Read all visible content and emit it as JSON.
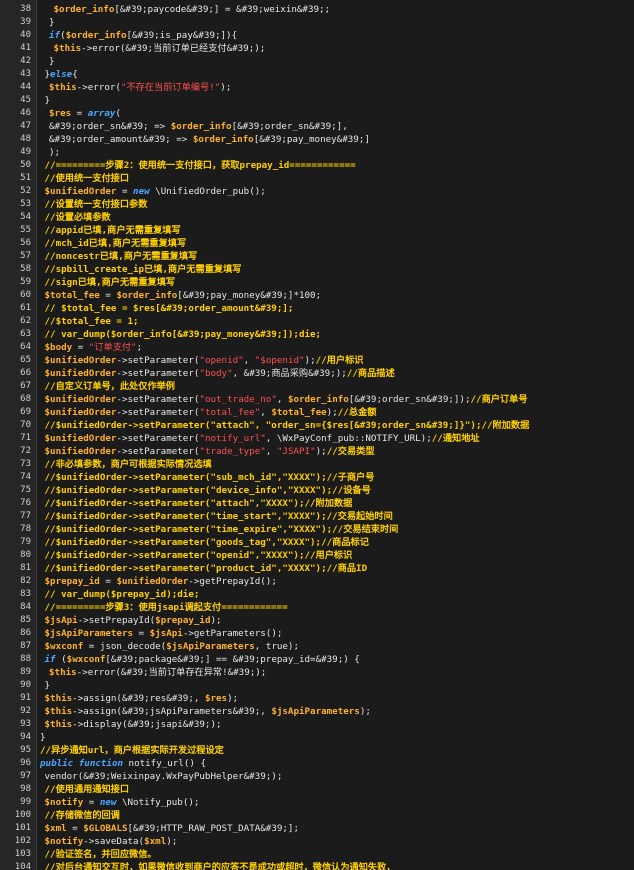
{
  "colors": {
    "background": "#1b1b1b",
    "gutter": "#262626",
    "line_number": "#cfcfcf",
    "plain": "#e6e6e6",
    "variable": "#ffb12b",
    "keyword": "#4aa8ff",
    "string": "#ff4f4f",
    "comment": "#ffd000"
  },
  "lines": [
    {
      "n": "38",
      "indent": 6,
      "tokens": [
        [
          "var",
          "$order_info"
        ],
        [
          "pl",
          "[&#39;paycode&#39;] = &#39;weixin&#39;;"
        ]
      ]
    },
    {
      "n": "39",
      "indent": 5,
      "tokens": [
        [
          "pl",
          "}"
        ]
      ]
    },
    {
      "n": "40",
      "indent": 5,
      "tokens": [
        [
          "kw",
          "if"
        ],
        [
          "pl",
          "("
        ],
        [
          "var",
          "$order_info"
        ],
        [
          "pl",
          "[&#39;is_pay&#39;]){"
        ]
      ]
    },
    {
      "n": "41",
      "indent": 6,
      "tokens": [
        [
          "var",
          "$this"
        ],
        [
          "pl",
          "->error(&#39;当前订单已经支付&#39;);"
        ]
      ]
    },
    {
      "n": "42",
      "indent": 5,
      "tokens": [
        [
          "pl",
          "}"
        ]
      ]
    },
    {
      "n": "43",
      "indent": 4,
      "tokens": [
        [
          "pl",
          "}"
        ],
        [
          "kw",
          "else"
        ],
        [
          "pl",
          "{"
        ]
      ]
    },
    {
      "n": "44",
      "indent": 5,
      "tokens": [
        [
          "var",
          "$this"
        ],
        [
          "pl",
          "->error("
        ],
        [
          "str",
          "\"不存在当前订单编号!\""
        ],
        [
          "pl",
          ");"
        ]
      ]
    },
    {
      "n": "45",
      "indent": 4,
      "tokens": [
        [
          "pl",
          "}"
        ]
      ]
    },
    {
      "n": "46",
      "indent": 5,
      "tokens": [
        [
          "var",
          "$res"
        ],
        [
          "pl",
          " = "
        ],
        [
          "kw",
          "array"
        ],
        [
          "pl",
          "("
        ]
      ]
    },
    {
      "n": "47",
      "indent": 5,
      "tokens": [
        [
          "pl",
          "&#39;order_sn&#39; => "
        ],
        [
          "var",
          "$order_info"
        ],
        [
          "pl",
          "[&#39;order_sn&#39;],"
        ]
      ]
    },
    {
      "n": "48",
      "indent": 5,
      "tokens": [
        [
          "pl",
          "&#39;order_amount&#39; => "
        ],
        [
          "var",
          "$order_info"
        ],
        [
          "pl",
          "[&#39;pay_money&#39;]"
        ]
      ]
    },
    {
      "n": "49",
      "indent": 5,
      "tokens": [
        [
          "pl",
          ");"
        ]
      ]
    },
    {
      "n": "50",
      "indent": 4,
      "tokens": [
        [
          "cm",
          "//=========步骤2：使用统一支付接口，获取prepay_id============"
        ]
      ]
    },
    {
      "n": "51",
      "indent": 4,
      "tokens": [
        [
          "cm",
          "//使用统一支付接口"
        ]
      ]
    },
    {
      "n": "52",
      "indent": 4,
      "tokens": [
        [
          "var",
          "$unifiedOrder"
        ],
        [
          "pl",
          " = "
        ],
        [
          "kw",
          "new"
        ],
        [
          "pl",
          " \\UnifiedOrder_pub();"
        ]
      ]
    },
    {
      "n": "53",
      "indent": 4,
      "tokens": [
        [
          "cm",
          "//设置统一支付接口参数"
        ]
      ]
    },
    {
      "n": "54",
      "indent": 4,
      "tokens": [
        [
          "cm",
          "//设置必填参数"
        ]
      ]
    },
    {
      "n": "55",
      "indent": 4,
      "tokens": [
        [
          "cm",
          "//appid已填,商户无需重复填写"
        ]
      ]
    },
    {
      "n": "56",
      "indent": 4,
      "tokens": [
        [
          "cm",
          "//mch_id已填,商户无需重复填写"
        ]
      ]
    },
    {
      "n": "57",
      "indent": 4,
      "tokens": [
        [
          "cm",
          "//noncestr已填,商户无需重复填写"
        ]
      ]
    },
    {
      "n": "58",
      "indent": 4,
      "tokens": [
        [
          "cm",
          "//spbill_create_ip已填,商户无需重复填写"
        ]
      ]
    },
    {
      "n": "59",
      "indent": 4,
      "tokens": [
        [
          "cm",
          "//sign已填,商户无需重复填写"
        ]
      ]
    },
    {
      "n": "60",
      "indent": 4,
      "tokens": [
        [
          "var",
          "$total_fee"
        ],
        [
          "pl",
          " = "
        ],
        [
          "var",
          "$order_info"
        ],
        [
          "pl",
          "[&#39;pay_money&#39;]*100;"
        ]
      ]
    },
    {
      "n": "61",
      "indent": 4,
      "tokens": [
        [
          "cm",
          "// $total_fee = $res[&#39;order_amount&#39;];"
        ]
      ]
    },
    {
      "n": "62",
      "indent": 4,
      "tokens": [
        [
          "cm",
          "//$total_fee = 1;"
        ]
      ]
    },
    {
      "n": "63",
      "indent": 4,
      "tokens": [
        [
          "cm",
          "// var_dump($order_info[&#39;pay_money&#39;]);die;"
        ]
      ]
    },
    {
      "n": "64",
      "indent": 4,
      "tokens": [
        [
          "var",
          "$body"
        ],
        [
          "pl",
          " = "
        ],
        [
          "str",
          "\"订单支付\""
        ],
        [
          "pl",
          ";"
        ]
      ]
    },
    {
      "n": "65",
      "indent": 4,
      "tokens": [
        [
          "var",
          "$unifiedOrder"
        ],
        [
          "pl",
          "->setParameter("
        ],
        [
          "str",
          "\"openid\""
        ],
        [
          "pl",
          ", "
        ],
        [
          "str",
          "\"$openid\""
        ],
        [
          "pl",
          ");"
        ],
        [
          "cm",
          "//用户标识"
        ]
      ]
    },
    {
      "n": "66",
      "indent": 4,
      "tokens": [
        [
          "var",
          "$unifiedOrder"
        ],
        [
          "pl",
          "->setParameter("
        ],
        [
          "str",
          "\"body\""
        ],
        [
          "pl",
          ", &#39;商品采购&#39;);"
        ],
        [
          "cm",
          "//商品描述"
        ]
      ]
    },
    {
      "n": "67",
      "indent": 4,
      "tokens": [
        [
          "cm",
          "//自定义订单号，此处仅作举例"
        ]
      ]
    },
    {
      "n": "68",
      "indent": 4,
      "tokens": [
        [
          "var",
          "$unifiedOrder"
        ],
        [
          "pl",
          "->setParameter("
        ],
        [
          "str",
          "\"out_trade_no\""
        ],
        [
          "pl",
          ", "
        ],
        [
          "var",
          "$order_info"
        ],
        [
          "pl",
          "[&#39;order_sn&#39;]);"
        ],
        [
          "cm",
          "//商户订单号"
        ]
      ]
    },
    {
      "n": "69",
      "indent": 4,
      "tokens": [
        [
          "var",
          "$unifiedOrder"
        ],
        [
          "pl",
          "->setParameter("
        ],
        [
          "str",
          "\"total_fee\""
        ],
        [
          "pl",
          ", "
        ],
        [
          "var",
          "$total_fee"
        ],
        [
          "pl",
          ");"
        ],
        [
          "cm",
          "//总金额"
        ]
      ]
    },
    {
      "n": "70",
      "indent": 4,
      "tokens": [
        [
          "cm",
          "//$unifiedOrder->setParameter(\"attach\", \"order_sn={$res[&#39;order_sn&#39;]}\");//附加数据"
        ]
      ]
    },
    {
      "n": "71",
      "indent": 4,
      "tokens": [
        [
          "var",
          "$unifiedOrder"
        ],
        [
          "pl",
          "->setParameter("
        ],
        [
          "str",
          "\"notify_url\""
        ],
        [
          "pl",
          ", \\WxPayConf_pub::NOTIFY_URL);"
        ],
        [
          "cm",
          "//通知地址"
        ]
      ]
    },
    {
      "n": "72",
      "indent": 4,
      "tokens": [
        [
          "var",
          "$unifiedOrder"
        ],
        [
          "pl",
          "->setParameter("
        ],
        [
          "str",
          "\"trade_type\""
        ],
        [
          "pl",
          ", "
        ],
        [
          "str",
          "\"JSAPI\""
        ],
        [
          "pl",
          ");"
        ],
        [
          "cm",
          "//交易类型"
        ]
      ]
    },
    {
      "n": "73",
      "indent": 4,
      "tokens": [
        [
          "cm",
          "//非必填参数，商户可根据实际情况选填"
        ]
      ]
    },
    {
      "n": "74",
      "indent": 4,
      "tokens": [
        [
          "cm",
          "//$unifiedOrder->setParameter(\"sub_mch_id\",\"XXXX\");//子商户号"
        ]
      ]
    },
    {
      "n": "75",
      "indent": 4,
      "tokens": [
        [
          "cm",
          "//$unifiedOrder->setParameter(\"device_info\",\"XXXX\");//设备号"
        ]
      ]
    },
    {
      "n": "76",
      "indent": 4,
      "tokens": [
        [
          "cm",
          "//$unifiedOrder->setParameter(\"attach\",\"XXXX\");//附加数据"
        ]
      ]
    },
    {
      "n": "77",
      "indent": 4,
      "tokens": [
        [
          "cm",
          "//$unifiedOrder->setParameter(\"time_start\",\"XXXX\");//交易起始时间"
        ]
      ]
    },
    {
      "n": "78",
      "indent": 4,
      "tokens": [
        [
          "cm",
          "//$unifiedOrder->setParameter(\"time_expire\",\"XXXX\");//交易结束时间"
        ]
      ]
    },
    {
      "n": "79",
      "indent": 4,
      "tokens": [
        [
          "cm",
          "//$unifiedOrder->setParameter(\"goods_tag\",\"XXXX\");//商品标记"
        ]
      ]
    },
    {
      "n": "80",
      "indent": 4,
      "tokens": [
        [
          "cm",
          "//$unifiedOrder->setParameter(\"openid\",\"XXXX\");//用户标识"
        ]
      ]
    },
    {
      "n": "81",
      "indent": 4,
      "tokens": [
        [
          "cm",
          "//$unifiedOrder->setParameter(\"product_id\",\"XXXX\");//商品ID"
        ]
      ]
    },
    {
      "n": "82",
      "indent": 4,
      "tokens": [
        [
          "var",
          "$prepay_id"
        ],
        [
          "pl",
          " = "
        ],
        [
          "var",
          "$unifiedOrder"
        ],
        [
          "pl",
          "->getPrepayId();"
        ]
      ]
    },
    {
      "n": "83",
      "indent": 4,
      "tokens": [
        [
          "cm",
          "// var_dump($prepay_id);die;"
        ]
      ]
    },
    {
      "n": "84",
      "indent": 4,
      "tokens": [
        [
          "cm",
          "//=========步骤3：使用jsapi调起支付============"
        ]
      ]
    },
    {
      "n": "85",
      "indent": 4,
      "tokens": [
        [
          "var",
          "$jsApi"
        ],
        [
          "pl",
          "->setPrepayId("
        ],
        [
          "var",
          "$prepay_id"
        ],
        [
          "pl",
          ");"
        ]
      ]
    },
    {
      "n": "86",
      "indent": 4,
      "tokens": [
        [
          "var",
          "$jsApiParameters"
        ],
        [
          "pl",
          " = "
        ],
        [
          "var",
          "$jsApi"
        ],
        [
          "pl",
          "->getParameters();"
        ]
      ]
    },
    {
      "n": "87",
      "indent": 4,
      "tokens": [
        [
          "var",
          "$wxconf"
        ],
        [
          "pl",
          " = json_decode("
        ],
        [
          "var",
          "$jsApiParameters"
        ],
        [
          "pl",
          ", true);"
        ]
      ]
    },
    {
      "n": "88",
      "indent": 4,
      "tokens": [
        [
          "kw",
          "if"
        ],
        [
          "pl",
          " ("
        ],
        [
          "var",
          "$wxconf"
        ],
        [
          "pl",
          "[&#39;package&#39;] == &#39;prepay_id=&#39;) {"
        ]
      ]
    },
    {
      "n": "89",
      "indent": 5,
      "tokens": [
        [
          "var",
          "$this"
        ],
        [
          "pl",
          "->error(&#39;当前订单存在异常!&#39;);"
        ]
      ]
    },
    {
      "n": "90",
      "indent": 4,
      "tokens": [
        [
          "pl",
          "}"
        ]
      ]
    },
    {
      "n": "91",
      "indent": 4,
      "tokens": [
        [
          "var",
          "$this"
        ],
        [
          "pl",
          "->assign(&#39;res&#39;, "
        ],
        [
          "var",
          "$res"
        ],
        [
          "pl",
          ");"
        ]
      ]
    },
    {
      "n": "92",
      "indent": 4,
      "tokens": [
        [
          "var",
          "$this"
        ],
        [
          "pl",
          "->assign(&#39;jsApiParameters&#39;, "
        ],
        [
          "var",
          "$jsApiParameters"
        ],
        [
          "pl",
          ");"
        ]
      ]
    },
    {
      "n": "93",
      "indent": 4,
      "tokens": [
        [
          "var",
          "$this"
        ],
        [
          "pl",
          "->display(&#39;jsapi&#39;);"
        ]
      ]
    },
    {
      "n": "94",
      "indent": 3,
      "tokens": [
        [
          "pl",
          "}"
        ]
      ]
    },
    {
      "n": "95",
      "indent": 3,
      "tokens": [
        [
          "cm",
          "//异步通知url，商户根据实际开发过程设定"
        ]
      ]
    },
    {
      "n": "96",
      "indent": 3,
      "tokens": [
        [
          "kw",
          "public"
        ],
        [
          "pl",
          " "
        ],
        [
          "kw",
          "function"
        ],
        [
          "pl",
          " notify_url() {"
        ]
      ]
    },
    {
      "n": "97",
      "indent": 4,
      "tokens": [
        [
          "pl",
          "vendor(&#39;Weixinpay.WxPayPubHelper&#39;);"
        ]
      ]
    },
    {
      "n": "98",
      "indent": 4,
      "tokens": [
        [
          "cm",
          "//使用通用通知接口"
        ]
      ]
    },
    {
      "n": "99",
      "indent": 4,
      "tokens": [
        [
          "var",
          "$notify"
        ],
        [
          "pl",
          " = "
        ],
        [
          "kw",
          "new"
        ],
        [
          "pl",
          " \\Notify_pub();"
        ]
      ]
    },
    {
      "n": "100",
      "indent": 4,
      "tokens": [
        [
          "cm",
          "//存储微信的回调"
        ]
      ]
    },
    {
      "n": "101",
      "indent": 4,
      "tokens": [
        [
          "var",
          "$xml"
        ],
        [
          "pl",
          " = "
        ],
        [
          "var",
          "$GLOBALS"
        ],
        [
          "pl",
          "[&#39;HTTP_RAW_POST_DATA&#39;];"
        ]
      ]
    },
    {
      "n": "102",
      "indent": 4,
      "tokens": [
        [
          "var",
          "$notify"
        ],
        [
          "pl",
          "->saveData("
        ],
        [
          "var",
          "$xml"
        ],
        [
          "pl",
          ");"
        ]
      ]
    },
    {
      "n": "103",
      "indent": 4,
      "tokens": [
        [
          "cm",
          "//验证签名，并回应微信。"
        ]
      ]
    },
    {
      "n": "104",
      "indent": 4,
      "tokens": [
        [
          "cm",
          "//对后台通知交互时，如果微信收到商户的应答不是成功或超时，微信认为通知失败，"
        ]
      ]
    }
  ]
}
